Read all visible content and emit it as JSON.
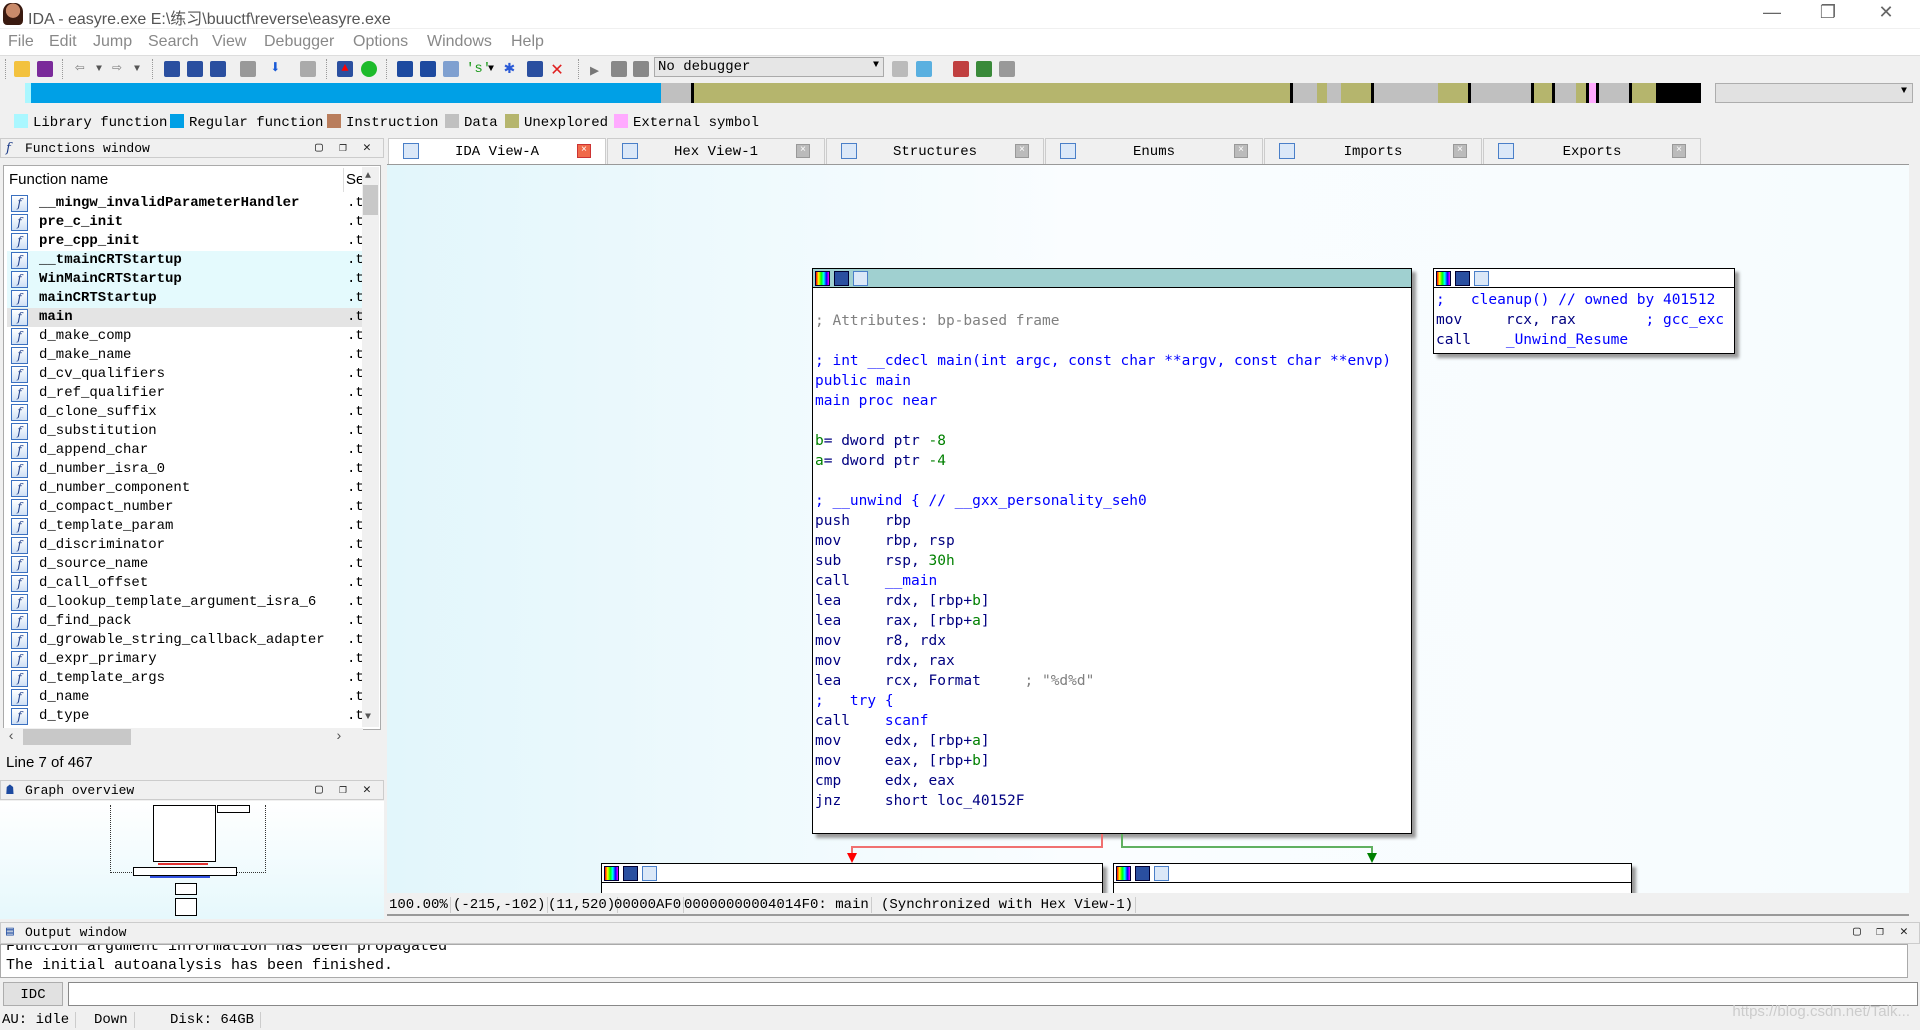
{
  "window": {
    "title": "IDA - easyre.exe E:\\练习\\buuctf\\reverse\\easyre.exe",
    "controls": [
      "—",
      "❐",
      "✕"
    ]
  },
  "menu": [
    "File",
    "Edit",
    "Jump",
    "Search",
    "View",
    "Debugger",
    "Options",
    "Windows",
    "Help"
  ],
  "toolbar": {
    "debugger_select": "No debugger"
  },
  "legend": [
    {
      "label": "Library function",
      "color": "#aaf7ff"
    },
    {
      "label": "Regular function",
      "color": "#00a0e6"
    },
    {
      "label": "Instruction",
      "color": "#b97d5c"
    },
    {
      "label": "Data",
      "color": "#c0c0c0"
    },
    {
      "label": "Unexplored",
      "color": "#b5b56d"
    },
    {
      "label": "External symbol",
      "color": "#ffaaff"
    }
  ],
  "functions_window": {
    "title": "Functions window",
    "columns": [
      "Function name",
      "Se"
    ],
    "rows": [
      {
        "name": "__mingw_invalidParameterHandler",
        "seg": ".t",
        "bold": true
      },
      {
        "name": "pre_c_init",
        "seg": ".t",
        "bold": true
      },
      {
        "name": "pre_cpp_init",
        "seg": ".t",
        "bold": true
      },
      {
        "name": "__tmainCRTStartup",
        "seg": ".t",
        "bold": true,
        "lib": true
      },
      {
        "name": "WinMainCRTStartup",
        "seg": ".t",
        "bold": true,
        "lib": true
      },
      {
        "name": "mainCRTStartup",
        "seg": ".t",
        "bold": true,
        "lib": true
      },
      {
        "name": "main",
        "seg": ".t",
        "bold": true,
        "selected": true
      },
      {
        "name": "d_make_comp",
        "seg": ".t"
      },
      {
        "name": "d_make_name",
        "seg": ".t"
      },
      {
        "name": "d_cv_qualifiers",
        "seg": ".t"
      },
      {
        "name": "d_ref_qualifier",
        "seg": ".t"
      },
      {
        "name": "d_clone_suffix",
        "seg": ".t"
      },
      {
        "name": "d_substitution",
        "seg": ".t"
      },
      {
        "name": "d_append_char",
        "seg": ".t"
      },
      {
        "name": "d_number_isra_0",
        "seg": ".t"
      },
      {
        "name": "d_number_component",
        "seg": ".t"
      },
      {
        "name": "d_compact_number",
        "seg": ".t"
      },
      {
        "name": "d_template_param",
        "seg": ".t"
      },
      {
        "name": "d_discriminator",
        "seg": ".t"
      },
      {
        "name": "d_source_name",
        "seg": ".t"
      },
      {
        "name": "d_call_offset",
        "seg": ".t"
      },
      {
        "name": "d_lookup_template_argument_isra_6",
        "seg": ".t"
      },
      {
        "name": "d_find_pack",
        "seg": ".t"
      },
      {
        "name": "d_growable_string_callback_adapter",
        "seg": ".t"
      },
      {
        "name": "d_expr_primary",
        "seg": ".t"
      },
      {
        "name": "d_template_args",
        "seg": ".t"
      },
      {
        "name": "d_name",
        "seg": ".t"
      },
      {
        "name": "d_type",
        "seg": ".t"
      }
    ],
    "line_status": "Line 7 of 467"
  },
  "graph_overview": {
    "title": "Graph overview"
  },
  "tabs": [
    {
      "label": "IDA View-A",
      "active": true
    },
    {
      "label": "Hex View-1"
    },
    {
      "label": "Structures"
    },
    {
      "label": "Enums"
    },
    {
      "label": "Imports"
    },
    {
      "label": "Exports"
    }
  ],
  "main_block": {
    "lines": [
      [],
      [
        {
          "t": "; Attributes: bp-based frame",
          "k": "gray"
        }
      ],
      [],
      [
        {
          "t": "; int __cdecl main(int argc, const char **argv, const char **envp)",
          "k": "blue"
        }
      ],
      [
        {
          "t": "public main",
          "k": "blue"
        }
      ],
      [
        {
          "t": "main proc near",
          "k": "blue"
        }
      ],
      [],
      [
        {
          "t": "b",
          "k": "green"
        },
        {
          "t": "= dword ptr ",
          "k": "navy"
        },
        {
          "t": "-8",
          "k": "green"
        }
      ],
      [
        {
          "t": "a",
          "k": "green"
        },
        {
          "t": "= dword ptr ",
          "k": "navy"
        },
        {
          "t": "-4",
          "k": "green"
        }
      ],
      [],
      [
        {
          "t": "; __unwind { // __gxx_personality_seh0",
          "k": "blue"
        }
      ],
      [
        {
          "t": "push    rbp",
          "k": "navy"
        }
      ],
      [
        {
          "t": "mov     rbp, rsp",
          "k": "navy"
        }
      ],
      [
        {
          "t": "sub     rsp, ",
          "k": "navy"
        },
        {
          "t": "30h",
          "k": "green"
        }
      ],
      [
        {
          "t": "call    ",
          "k": "navy"
        },
        {
          "t": "__main",
          "k": "blue"
        }
      ],
      [
        {
          "t": "lea     rdx, [rbp+",
          "k": "navy"
        },
        {
          "t": "b",
          "k": "green"
        },
        {
          "t": "]",
          "k": "navy"
        }
      ],
      [
        {
          "t": "lea     rax, [rbp+",
          "k": "navy"
        },
        {
          "t": "a",
          "k": "green"
        },
        {
          "t": "]",
          "k": "navy"
        }
      ],
      [
        {
          "t": "mov     r8, rdx",
          "k": "navy"
        }
      ],
      [
        {
          "t": "mov     rdx, rax",
          "k": "navy"
        }
      ],
      [
        {
          "t": "lea     rcx, Format     ",
          "k": "navy"
        },
        {
          "t": "; \"%d%d\"",
          "k": "gray"
        }
      ],
      [
        {
          "t": ";   try {",
          "k": "blue"
        }
      ],
      [
        {
          "t": "call    ",
          "k": "navy"
        },
        {
          "t": "scanf",
          "k": "blue"
        }
      ],
      [
        {
          "t": "mov     edx, [rbp+",
          "k": "navy"
        },
        {
          "t": "a",
          "k": "green"
        },
        {
          "t": "]",
          "k": "navy"
        }
      ],
      [
        {
          "t": "mov     eax, [rbp+",
          "k": "navy"
        },
        {
          "t": "b",
          "k": "green"
        },
        {
          "t": "]",
          "k": "navy"
        }
      ],
      [
        {
          "t": "cmp     edx, eax",
          "k": "navy"
        }
      ],
      [
        {
          "t": "jnz     short loc_40152F",
          "k": "navy"
        }
      ]
    ]
  },
  "cleanup_block": {
    "lines": [
      [
        {
          "t": ";   cleanup() // owned by 401512",
          "k": "blue"
        }
      ],
      [
        {
          "t": "mov     rcx, rax        ",
          "k": "navy"
        },
        {
          "t": "; gcc_exc",
          "k": "blue"
        }
      ],
      [
        {
          "t": "call    ",
          "k": "navy"
        },
        {
          "t": "_Unwind_Resume",
          "k": "blue"
        }
      ]
    ]
  },
  "edges": {
    "false_color": "#ff0000",
    "true_color": "#008000"
  },
  "graph_status": [
    "100.00%",
    "(-215,-102)",
    "(11,520)",
    "00000AF0",
    "00000000004014F0: main",
    "(Synchronized with Hex View-1)"
  ],
  "output_window": {
    "title": "Output window",
    "lines": [
      "Function argument information has been propagated",
      "The initial autoanalysis has been finished."
    ],
    "idc_button": "IDC"
  },
  "status_bar": [
    "AU:  idle",
    "Down",
    "Disk: 64GB"
  ],
  "watermark": "https://blog.csdn.net/Talk..."
}
